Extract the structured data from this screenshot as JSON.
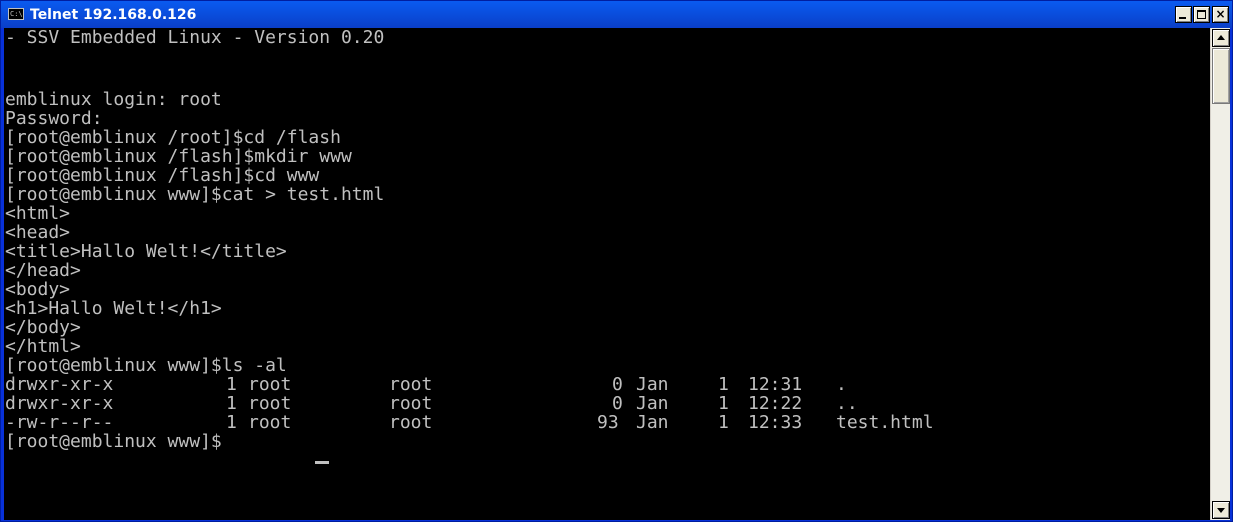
{
  "window": {
    "title": "Telnet 192.168.0.126",
    "icon": "console-icon",
    "icon_glyph": "C:\\"
  },
  "controls": {
    "minimize": "minimize-icon",
    "maximize": "maximize-icon",
    "close_glyph": "×"
  },
  "console": {
    "lines": [
      "- SSV Embedded Linux - Version 0.20",
      "",
      "emblinux login: root",
      "Password:",
      "[root@emblinux /root]$cd /flash",
      "[root@emblinux /flash]$mkdir www",
      "[root@emblinux /flash]$cd www",
      "[root@emblinux www]$cat > test.html",
      "<html>",
      "<head>",
      "<title>Hallo Welt!</title>",
      "</head>",
      "<body>",
      "<h1>Hallo Welt!</h1>",
      "</body>",
      "</html>",
      "[root@emblinux www]$ls -al"
    ],
    "listing": [
      {
        "perms": "drwxr-xr-x",
        "links": "1",
        "owner": "root",
        "group": "root",
        "size": "0",
        "month": "Jan",
        "day": "1",
        "time": "12:31",
        "name": "."
      },
      {
        "perms": "drwxr-xr-x",
        "links": "1",
        "owner": "root",
        "group": "root",
        "size": "0",
        "month": "Jan",
        "day": "1",
        "time": "12:22",
        "name": ".."
      },
      {
        "perms": "-rw-r--r--",
        "links": "1",
        "owner": "root",
        "group": "root",
        "size": "93",
        "month": "Jan",
        "day": "1",
        "time": "12:33",
        "name": "test.html"
      }
    ],
    "prompt": "[root@emblinux www]$",
    "text_color": "#c0c0c0",
    "background": "#000000"
  },
  "scrollbar": {
    "up_icon": "scroll-up-arrow-icon",
    "down_icon": "scroll-down-arrow-icon"
  }
}
